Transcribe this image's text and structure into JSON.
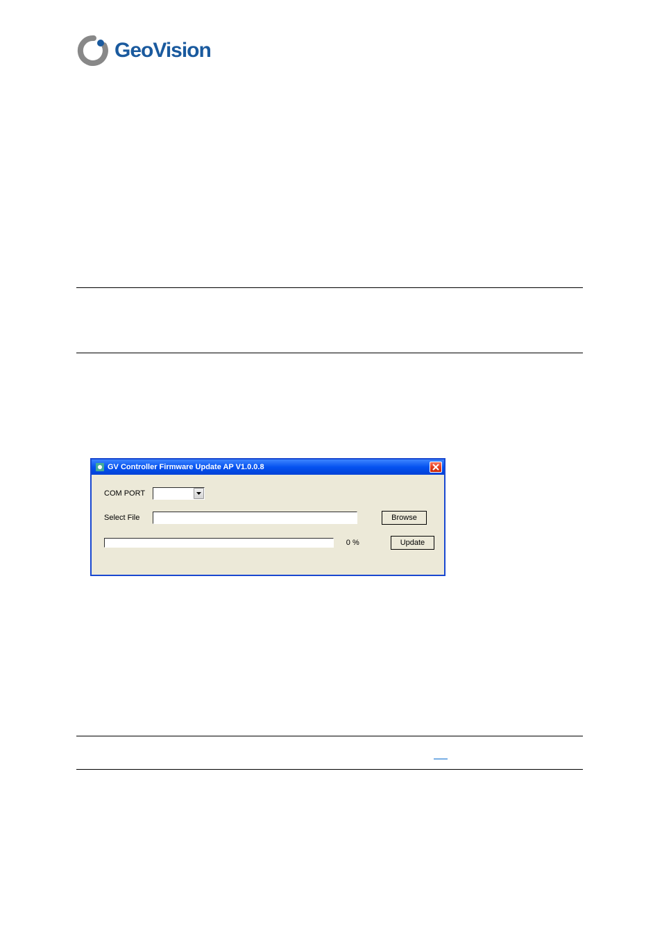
{
  "logo": {
    "text": "GeoVision",
    "icon_name": "geovision-logo-icon"
  },
  "dialog": {
    "title": "GV Controller Firmware Update AP V1.0.0.8",
    "labels": {
      "com_port": "COM PORT",
      "select_file": "Select File"
    },
    "fields": {
      "com_port_value": "",
      "select_file_value": ""
    },
    "buttons": {
      "browse": "Browse",
      "update": "Update"
    },
    "progress": {
      "value": 0,
      "text": "0  %"
    },
    "close_icon": "close-x"
  }
}
